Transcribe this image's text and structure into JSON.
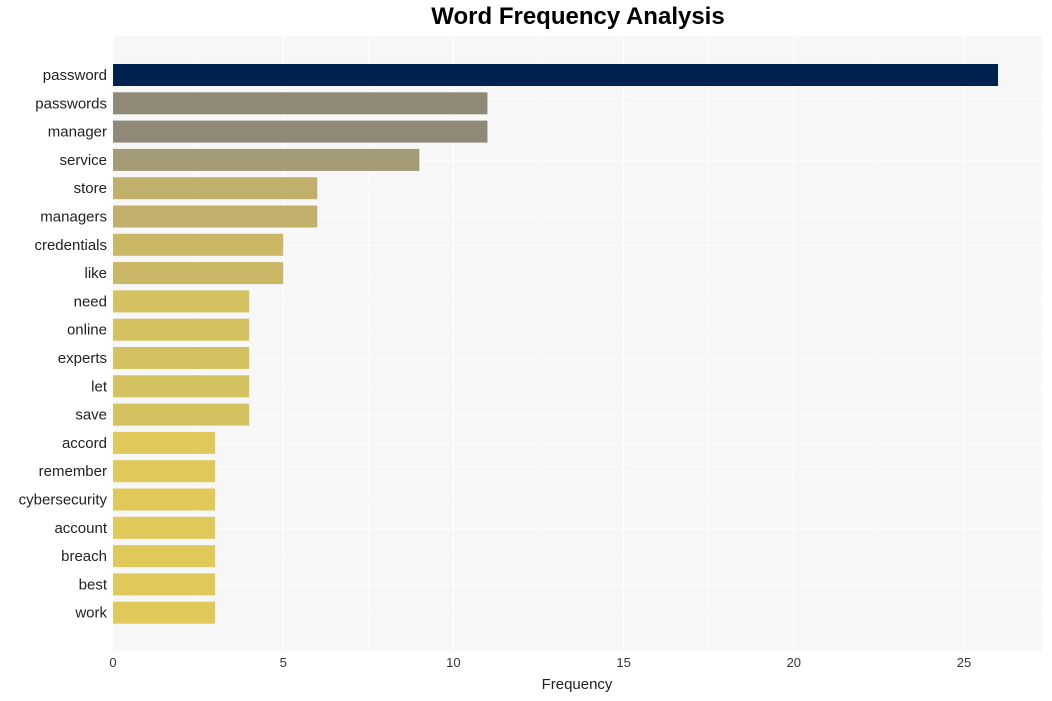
{
  "chart_data": {
    "type": "bar",
    "orientation": "horizontal",
    "title": "Word Frequency Analysis",
    "xlabel": "Frequency",
    "ylabel": "",
    "xlim": [
      0,
      27.3
    ],
    "xticks": [
      0,
      5,
      10,
      15,
      20,
      25
    ],
    "grid": true,
    "legend": "none",
    "categories": [
      "password",
      "passwords",
      "manager",
      "service",
      "store",
      "managers",
      "credentials",
      "like",
      "need",
      "online",
      "experts",
      "let",
      "save",
      "accord",
      "remember",
      "cybersecurity",
      "account",
      "breach",
      "best",
      "work"
    ],
    "values": [
      26,
      11,
      11,
      9,
      6,
      6,
      5,
      5,
      4,
      4,
      4,
      4,
      4,
      3,
      3,
      3,
      3,
      3,
      3,
      3
    ],
    "colors": [
      "#00224e",
      "#8f8a77",
      "#8f8a77",
      "#a29b76",
      "#c0b06c",
      "#c0b06c",
      "#cab866",
      "#cab866",
      "#d4c15f",
      "#d4c15f",
      "#d4c15f",
      "#d4c15f",
      "#d4c15f",
      "#e0c95a",
      "#e0c95a",
      "#e0c95a",
      "#e0c95a",
      "#e0c95a",
      "#e0c95a",
      "#e0c95a"
    ]
  }
}
